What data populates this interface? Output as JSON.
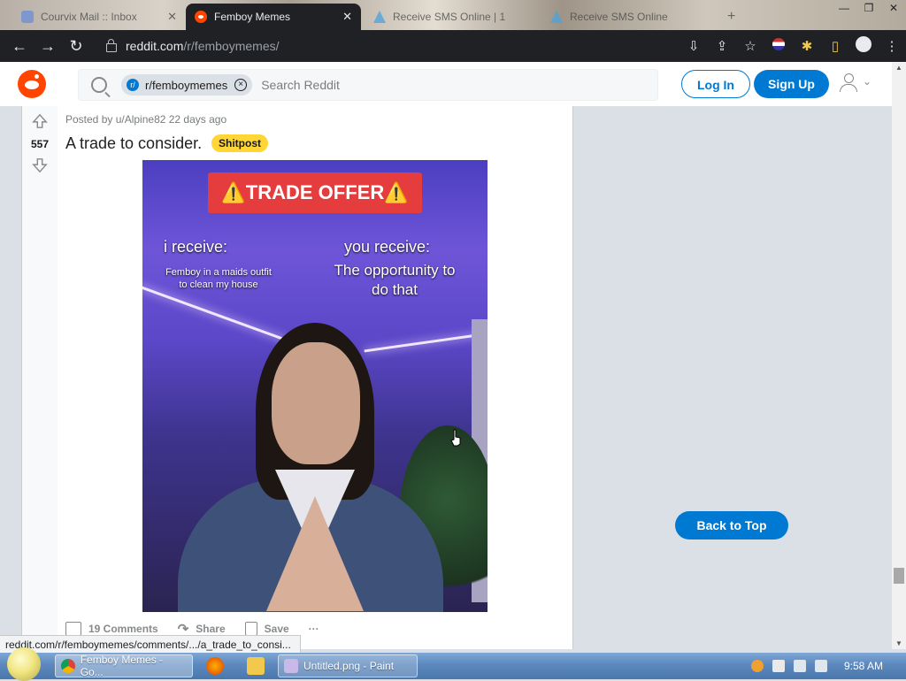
{
  "browser": {
    "tabs": [
      {
        "label": "Courvix Mail :: Inbox",
        "active": false
      },
      {
        "label": "Femboy Memes",
        "active": true
      },
      {
        "label": "Receive SMS Online | 1",
        "active": false
      },
      {
        "label": "Receive SMS Online",
        "active": false
      }
    ],
    "url_host": "reddit.com",
    "url_path": "/r/femboymemes/",
    "status_url": "reddit.com/r/femboymemes/comments/.../a_trade_to_consi..."
  },
  "reddit": {
    "search_chip": "r/femboymemes",
    "search_placeholder": "Search Reddit",
    "login_label": "Log In",
    "signup_label": "Sign Up",
    "back_to_top_label": "Back to Top"
  },
  "post": {
    "votes": "557",
    "posted_by": "Posted by u/Alpine82 22 days ago",
    "title": "A trade to consider.",
    "flair": "Shitpost",
    "flair_color": "#ffd635",
    "comments_label": "19 Comments",
    "share_label": "Share",
    "save_label": "Save",
    "more_label": "···",
    "media": {
      "banner": "⚠️TRADE OFFER⚠️",
      "left_heading": "i receive:",
      "left_text": "Femboy in a maids outfit to clean my house",
      "right_heading": "you receive:",
      "right_text": "The opportunity to do that"
    }
  },
  "taskbar": {
    "items": [
      {
        "label": "Femboy Memes - Go...",
        "active": true
      },
      {
        "label": "Untitled.png - Paint",
        "active": false
      }
    ],
    "clock": "9:58 AM"
  },
  "colors": {
    "reddit_orange": "#ff4500",
    "reddit_blue": "#0079d3",
    "chrome_dark": "#202124"
  }
}
